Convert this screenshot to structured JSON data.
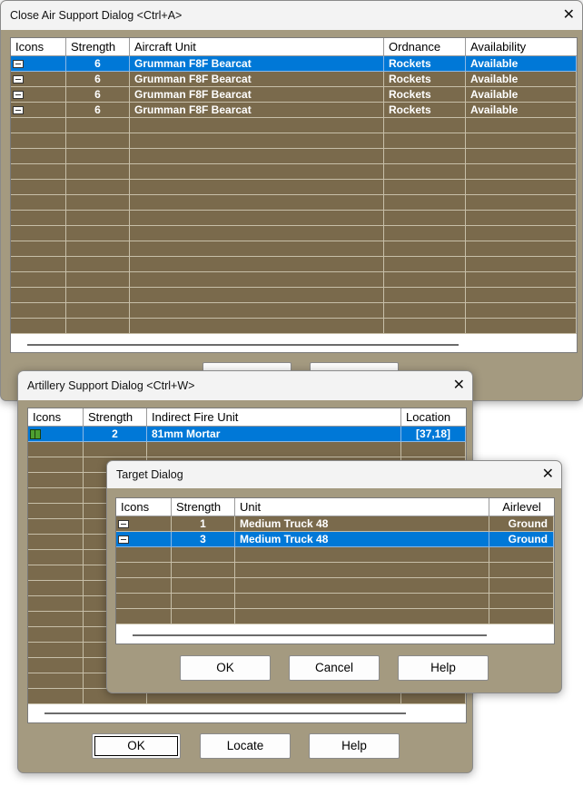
{
  "colors": {
    "accent": "#0078d7",
    "row_bg": "#7a6a4c",
    "dialog_bg": "#a49a80"
  },
  "air_dialog": {
    "title": "Close Air Support Dialog <Ctrl+A>",
    "close_glyph": "✕",
    "columns": [
      "Icons",
      "Strength",
      "Aircraft Unit",
      "Ordnance",
      "Availability"
    ],
    "rows": [
      {
        "icon": "aircraft-unit-icon",
        "strength": "6",
        "unit": "Grumman F8F Bearcat",
        "ordnance": "Rockets",
        "availability": "Available"
      },
      {
        "icon": "aircraft-unit-icon",
        "strength": "6",
        "unit": "Grumman F8F Bearcat",
        "ordnance": "Rockets",
        "availability": "Available"
      },
      {
        "icon": "aircraft-unit-icon",
        "strength": "6",
        "unit": "Grumman F8F Bearcat",
        "ordnance": "Rockets",
        "availability": "Available"
      },
      {
        "icon": "aircraft-unit-icon",
        "strength": "6",
        "unit": "Grumman F8F Bearcat",
        "ordnance": "Rockets",
        "availability": "Available"
      }
    ],
    "selected_row": 0,
    "empty_rows": 14
  },
  "artillery_dialog": {
    "title": "Artillery Support Dialog <Ctrl+W>",
    "close_glyph": "✕",
    "columns": [
      "Icons",
      "Strength",
      "Indirect Fire Unit",
      "Location"
    ],
    "rows": [
      {
        "icon": "mortar-unit-icon",
        "strength": "2",
        "unit": "81mm Mortar",
        "location": "[37,18]"
      }
    ],
    "selected_row": 0,
    "empty_rows": 17,
    "buttons": {
      "ok": "OK",
      "locate": "Locate",
      "help": "Help"
    }
  },
  "target_dialog": {
    "title": "Target Dialog",
    "close_glyph": "✕",
    "columns": [
      "Icons",
      "Strength",
      "Unit",
      "Airlevel"
    ],
    "rows": [
      {
        "icon": "truck-unit-icon",
        "strength": "1",
        "unit": "Medium Truck 48",
        "airlevel": "Ground"
      },
      {
        "icon": "truck-unit-icon",
        "strength": "3",
        "unit": "Medium Truck 48",
        "airlevel": "Ground"
      }
    ],
    "selected_row": 1,
    "empty_rows": 5,
    "buttons": {
      "ok": "OK",
      "cancel": "Cancel",
      "help": "Help"
    }
  }
}
